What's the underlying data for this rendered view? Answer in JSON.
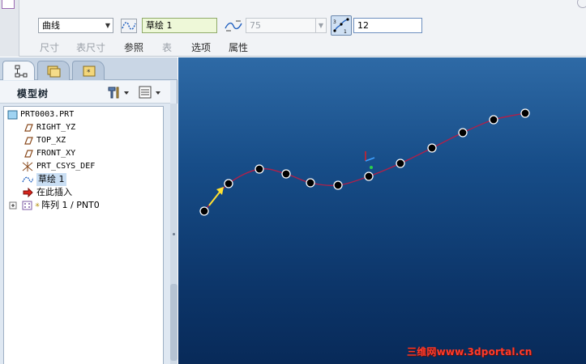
{
  "dashboard": {
    "type_select": "曲线",
    "sketch_ref": "草绘 1",
    "dimension_select": "75",
    "count_value": "12",
    "tabs": {
      "dimensions": "尺寸",
      "table_dimensions": "表尺寸",
      "references": "参照",
      "table": "表",
      "options": "选项",
      "properties": "属性"
    }
  },
  "navigator": {
    "tree_title": "模型树",
    "tree_items": [
      {
        "label": "PRT0003.PRT",
        "icon": "part-icon"
      },
      {
        "label": "RIGHT_YZ",
        "icon": "datum-plane-icon"
      },
      {
        "label": "TOP_XZ",
        "icon": "datum-plane-icon"
      },
      {
        "label": "FRONT_XY",
        "icon": "datum-plane-icon"
      },
      {
        "label": "PRT_CSYS_DEF",
        "icon": "csys-icon"
      },
      {
        "label": "草绘 1",
        "icon": "sketch-icon"
      },
      {
        "label": "在此插入",
        "icon": "insert-here-arrow-icon"
      },
      {
        "label": "阵列 1 / PNT0",
        "icon": "pattern-icon"
      }
    ]
  },
  "graphics": {
    "watermark": "三维网www.3dportal.cn"
  },
  "colors": {
    "curve": "#b0204a",
    "point_fill": "#000000",
    "point_stroke": "#ffffff",
    "direction_arrow": "#ffe233",
    "background_top": "#2e6aa6",
    "background_bottom": "#082a59"
  }
}
